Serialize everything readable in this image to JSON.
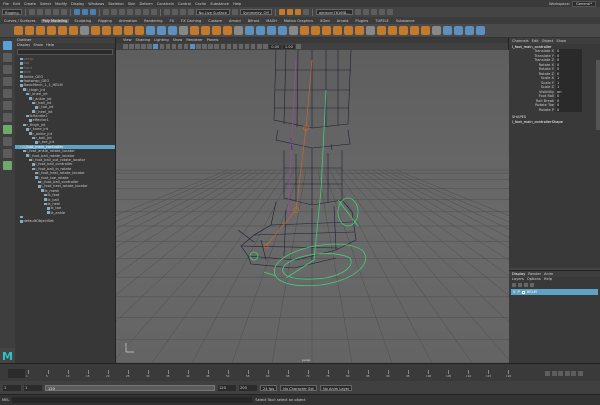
{
  "menubar": {
    "items": [
      "File",
      "Edit",
      "Create",
      "Select",
      "Modify",
      "Display",
      "Windows",
      "Skeleton",
      "Skin",
      "Deform",
      "Constrain",
      "Control",
      "Cache",
      "Substance",
      "Help"
    ],
    "workspace_label": "Workspace:",
    "workspace_value": "General*"
  },
  "statusline": {
    "mode": "Rigging",
    "surfaces": "No Live Surface",
    "symmetry": "Symmetry: Off",
    "signin": "ajmkorn7616f8..."
  },
  "shelf": {
    "tabs": [
      "Curves / Surfaces",
      "Poly Modeling",
      "Sculpting",
      "Rigging",
      "Animation",
      "Rendering",
      "FX",
      "FX Caching",
      "Custom",
      "Arnold",
      "Bifrost",
      "MASH",
      "Motion Graphics",
      "XGen",
      "Arnold",
      "Plugins",
      "TURTLE",
      "Substance"
    ],
    "active_index": 1
  },
  "outliner": {
    "title": "Outliner",
    "menu": [
      "Display",
      "Show",
      "Help"
    ],
    "rows": [
      {
        "label": "persp",
        "indent": 1,
        "state": "dim"
      },
      {
        "label": "top",
        "indent": 1,
        "state": "dim"
      },
      {
        "label": "front",
        "indent": 1,
        "state": "dim"
      },
      {
        "label": "side",
        "indent": 1,
        "state": "dim"
      },
      {
        "label": "Ankle_GEO",
        "indent": 1,
        "state": ""
      },
      {
        "label": "footwrap_GEO",
        "indent": 1,
        "state": ""
      },
      {
        "label": "BasicMech_1_1_HELM",
        "indent": 1,
        "state": ""
      },
      {
        "label": "l_thigh_jnt",
        "indent": 2,
        "state": ""
      },
      {
        "label": "l_knee_jnt",
        "indent": 3,
        "state": ""
      },
      {
        "label": "l_ankle_jnt",
        "indent": 4,
        "state": ""
      },
      {
        "label": "l_ball_jnt",
        "indent": 5,
        "state": ""
      },
      {
        "label": "l_toe_jnt",
        "indent": 6,
        "state": ""
      },
      {
        "label": "l_heel_jnt",
        "indent": 5,
        "state": ""
      },
      {
        "label": "ikHandle1",
        "indent": 3,
        "state": ""
      },
      {
        "label": "effector1",
        "indent": 4,
        "state": ""
      },
      {
        "label": "r_thigh_jnt",
        "indent": 2,
        "state": ""
      },
      {
        "label": "r_knee_jnt",
        "indent": 3,
        "state": ""
      },
      {
        "label": "r_ankle_jnt",
        "indent": 4,
        "state": ""
      },
      {
        "label": "r_ball_jnt",
        "indent": 5,
        "state": ""
      },
      {
        "label": "r_toe_jnt",
        "indent": 6,
        "state": ""
      },
      {
        "label": "l_foot_main_controller",
        "indent": 1,
        "state": "selected"
      },
      {
        "label": "l_foot_ankle_rotate_locator",
        "indent": 2,
        "state": ""
      },
      {
        "label": "l_foot_ball_rotate_locator",
        "indent": 3,
        "state": ""
      },
      {
        "label": "l_foot_ball_out_rotate_locator",
        "indent": 4,
        "state": ""
      },
      {
        "label": "l_foot_ball_controller",
        "indent": 5,
        "state": ""
      },
      {
        "label": "l_foot_ball_in_rotate",
        "indent": 5,
        "state": ""
      },
      {
        "label": "l_foot_heel_rotate_locator",
        "indent": 6,
        "state": ""
      },
      {
        "label": "l_foot_toe_rotate",
        "indent": 6,
        "state": ""
      },
      {
        "label": "l_foot_ball_controller",
        "indent": 7,
        "state": ""
      },
      {
        "label": "l_foot_heel_rotate_locator",
        "indent": 7,
        "state": ""
      },
      {
        "label": "ik_mesh",
        "indent": 8,
        "state": ""
      },
      {
        "label": "ik_foot",
        "indent": 9,
        "state": ""
      },
      {
        "label": "ik_ball",
        "indent": 9,
        "state": ""
      },
      {
        "label": "ik_heel",
        "indent": 9,
        "state": ""
      },
      {
        "label": "ik_toe",
        "indent": 10,
        "state": ""
      },
      {
        "label": "ik_ankle",
        "indent": 10,
        "state": ""
      },
      {
        "label": "",
        "indent": 1,
        "state": ""
      },
      {
        "label": "defaultObjectSet",
        "indent": 1,
        "state": ""
      }
    ]
  },
  "viewport": {
    "menu": [
      "View",
      "Shading",
      "Lighting",
      "Show",
      "Renderer",
      "Panels"
    ],
    "field_a": "0.00",
    "field_b": "1.00",
    "camera": "persp"
  },
  "channelbox": {
    "tabs": [
      "Channels",
      "Edit",
      "Object",
      "Show"
    ],
    "object": "l_foot_main_controller",
    "attrs": [
      {
        "k": "Translate X",
        "v": "0"
      },
      {
        "k": "Translate Y",
        "v": "0"
      },
      {
        "k": "Translate Z",
        "v": "0"
      },
      {
        "k": "Rotate X",
        "v": "0"
      },
      {
        "k": "Rotate Y",
        "v": "0"
      },
      {
        "k": "Rotate Z",
        "v": "0"
      },
      {
        "k": "Scale X",
        "v": "1"
      },
      {
        "k": "Scale Y",
        "v": "1"
      },
      {
        "k": "Scale Z",
        "v": "1"
      },
      {
        "k": "Visibility",
        "v": "on"
      },
      {
        "k": "Foot Roll",
        "v": "0"
      },
      {
        "k": "Roll Break",
        "v": "0"
      },
      {
        "k": "Rotate Toe",
        "v": "0"
      },
      {
        "k": "Rotate P",
        "v": "0"
      }
    ],
    "shapes_header": "SHAPES",
    "shape_name": "l_foot_main_controllerShape"
  },
  "layers": {
    "tabs": [
      "Display",
      "Render",
      "Anim"
    ],
    "menu": [
      "Layers",
      "Options",
      "Help"
    ],
    "layer_v": "V",
    "layer_p": "P",
    "layer_name": "HELM"
  },
  "timeline": {
    "current": "1",
    "end": "120",
    "ticks": [
      "1",
      "5",
      "10",
      "15",
      "20",
      "25",
      "30",
      "35",
      "40",
      "45",
      "50",
      "55",
      "60",
      "65",
      "70",
      "75",
      "80",
      "85",
      "90",
      "95",
      "100",
      "105",
      "110",
      "115",
      "120"
    ]
  },
  "range": {
    "start": "1",
    "inner_start": "1",
    "bar_label": "120",
    "inner_end": "120",
    "end": "200",
    "fps": "24 fps",
    "character": "No Character Set",
    "anim_layer": "No Anim Layer"
  },
  "cmdline": {
    "lang": "MEL",
    "help": "Select Tool: select an object"
  }
}
